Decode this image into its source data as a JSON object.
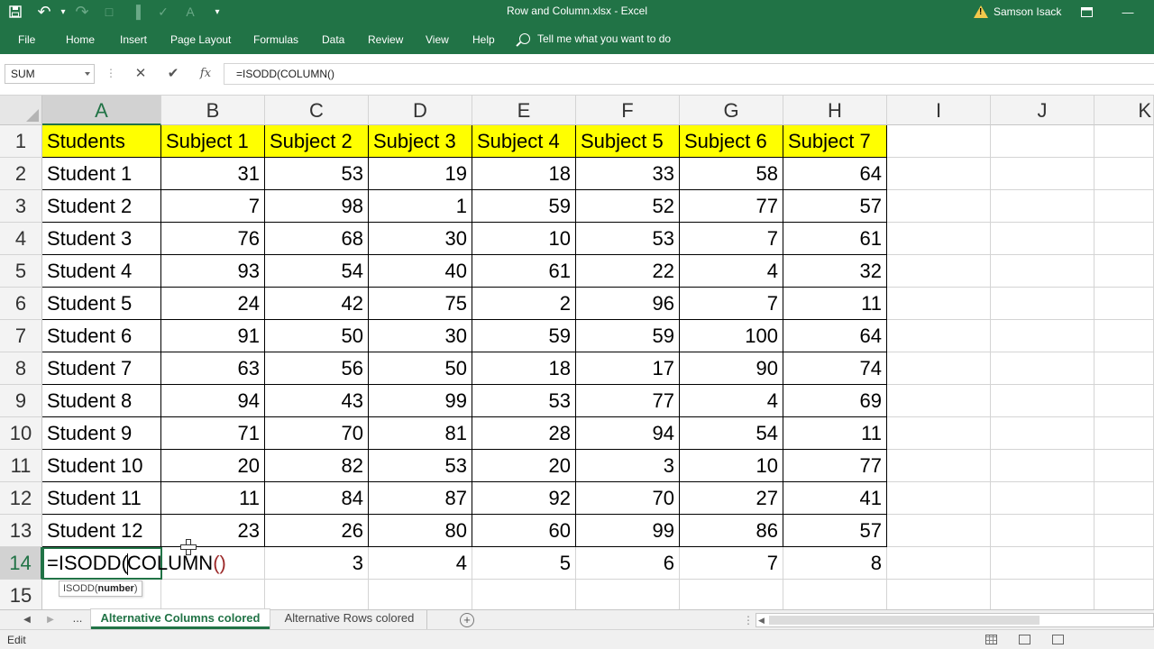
{
  "window": {
    "title": "Row and Column.xlsx  -  Excel",
    "user": "Samson Isack",
    "restore_icon": "restore-icon",
    "close_glyph": "—"
  },
  "qat": {
    "save": "💾",
    "undo": "↶",
    "undo_dd": "▾",
    "redo": "↷",
    "items": [
      "□",
      "▐",
      "✓",
      "A",
      "▾"
    ]
  },
  "ribbon": {
    "tabs": [
      "File",
      "Home",
      "Insert",
      "Page Layout",
      "Formulas",
      "Data",
      "Review",
      "View",
      "Help"
    ],
    "tell_me": "Tell me what you want to do"
  },
  "formula_bar": {
    "name_box": "SUM",
    "cancel": "✕",
    "enter": "✔",
    "fx": "fx",
    "formula": "=ISODD(COLUMN()"
  },
  "columns": [
    "A",
    "B",
    "C",
    "D",
    "E",
    "F",
    "G",
    "H",
    "I",
    "J",
    "K"
  ],
  "rows": [
    "1",
    "2",
    "3",
    "4",
    "5",
    "6",
    "7",
    "8",
    "9",
    "10",
    "11",
    "12",
    "13",
    "14",
    "15"
  ],
  "header_row": [
    "Students",
    "Subject 1",
    "Subject 2",
    "Subject 3",
    "Subject 4",
    "Subject 5",
    "Subject 6",
    "Subject 7"
  ],
  "data_rows": [
    [
      "Student 1",
      "31",
      "53",
      "19",
      "18",
      "33",
      "58",
      "64"
    ],
    [
      "Student 2",
      "7",
      "98",
      "1",
      "59",
      "52",
      "77",
      "57"
    ],
    [
      "Student 3",
      "76",
      "68",
      "30",
      "10",
      "53",
      "7",
      "61"
    ],
    [
      "Student 4",
      "93",
      "54",
      "40",
      "61",
      "22",
      "4",
      "32"
    ],
    [
      "Student 5",
      "24",
      "42",
      "75",
      "2",
      "96",
      "7",
      "11"
    ],
    [
      "Student 6",
      "91",
      "50",
      "30",
      "59",
      "59",
      "100",
      "64"
    ],
    [
      "Student 7",
      "63",
      "56",
      "50",
      "18",
      "17",
      "90",
      "74"
    ],
    [
      "Student 8",
      "94",
      "43",
      "99",
      "53",
      "77",
      "4",
      "69"
    ],
    [
      "Student 9",
      "71",
      "70",
      "81",
      "28",
      "94",
      "54",
      "11"
    ],
    [
      "Student 10",
      "20",
      "82",
      "53",
      "20",
      "3",
      "10",
      "77"
    ],
    [
      "Student 11",
      "11",
      "84",
      "87",
      "92",
      "70",
      "27",
      "41"
    ],
    [
      "Student 12",
      "23",
      "26",
      "80",
      "60",
      "99",
      "86",
      "57"
    ]
  ],
  "row14": [
    "3",
    "4",
    "5",
    "6",
    "7",
    "8"
  ],
  "editing": {
    "before_caret": "=ISODD(",
    "after_caret": "COLUMN",
    "parens": "()",
    "tooltip_fn": "ISODD(",
    "tooltip_arg": "number",
    "tooltip_close": ")"
  },
  "sheets": {
    "more": "...",
    "tabs": [
      "Alternative Columns colored",
      "Alternative Rows colored"
    ],
    "add": "+"
  },
  "status": {
    "mode": "Edit"
  },
  "colors": {
    "excel_green": "#217346",
    "header_fill": "#ffff00"
  }
}
